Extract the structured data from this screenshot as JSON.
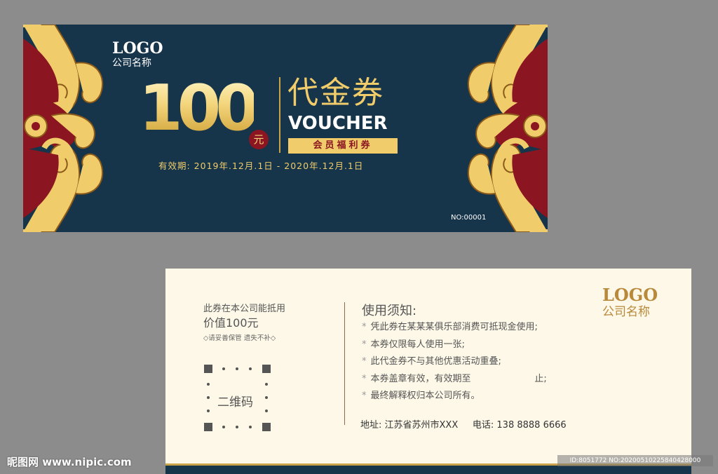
{
  "front": {
    "logo": "LOGO",
    "company": "公司名称",
    "amount": "100",
    "unit": "元",
    "title_cn": "代金券",
    "title_en": "VOUCHER",
    "badge": "会员福利券",
    "validity": "有效期: 2019年.12月.1日 - 2020年.12月.1日",
    "serial": "NO:00001"
  },
  "back": {
    "note_line1": "此券在本公司能抵用",
    "note_line2": "价值100元",
    "note_line3": "◇请妥善保管 遗失不补◇",
    "qr_label": "二维码",
    "rules_title": "使用须知:",
    "rules": [
      "凭此券在某某某俱乐部消费可抵现金使用;",
      "本券仅限每人使用一张;",
      "此代金券不与其他优惠活动重叠;",
      "本券盖章有效，有效期至                      止;",
      "最终解释权归本公司所有。"
    ],
    "address": "地址: 江苏省苏州市XXX     电话: 138 8888 6666",
    "logo": "LOGO",
    "company": "公司名称"
  },
  "watermark": {
    "site": "昵图网 www.nipic.com",
    "id_text": "ID:8051772 NO:20200510225840428000"
  },
  "colors": {
    "navy": "#16344a",
    "gold": "#f0cc6a",
    "crimson": "#8b1521",
    "cream": "#fdf8e8"
  }
}
